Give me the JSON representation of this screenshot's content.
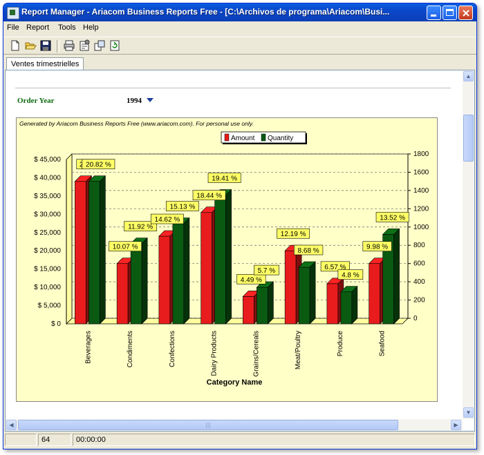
{
  "window": {
    "title": "Report Manager - Ariacom Business Reports Free - [C:\\Archivos de programa\\Ariacom\\Busi..."
  },
  "menu": [
    "File",
    "Report",
    "Tools",
    "Help"
  ],
  "toolbar": {
    "icons": [
      "new-icon",
      "open-icon",
      "save-icon",
      "print-icon",
      "properties-icon",
      "export-icon",
      "refresh-icon"
    ]
  },
  "tab": {
    "label": "Ventes trimestrielles"
  },
  "filter": {
    "label": "Order Year",
    "value": "1994"
  },
  "chart_caption": "Generated by Ariacom Business Reports Free (www.ariacom.com). For personal use only.",
  "chart_data": {
    "type": "bar",
    "xlabel": "Category Name",
    "categories": [
      "Beverages",
      "Condiments",
      "Confections",
      "Dairy Products",
      "Grains/Cereals",
      "Meat/Poultry",
      "Produce",
      "Seafood"
    ],
    "series": [
      {
        "name": "Amount",
        "axis": "left",
        "color": "#e81c1c",
        "values": [
          39000,
          16500,
          24000,
          30500,
          7500,
          20000,
          11000,
          16500
        ],
        "labels": [
          "23",
          "10.07 %",
          "14.62 %",
          "18.44 %",
          "4.49 %",
          "12.19 %",
          "6.57 %",
          "9.98 %"
        ]
      },
      {
        "name": "Quantity",
        "axis": "right",
        "color": "#0a5a12",
        "values": [
          1560,
          880,
          1100,
          1410,
          400,
          620,
          350,
          980
        ],
        "labels": [
          "20.82 %",
          "11.92 %",
          "15.13 %",
          "19.41 %",
          "5.7 %",
          "8.68 %",
          "4.8 %",
          "13.52 %"
        ]
      }
    ],
    "left_axis": {
      "ylim": [
        0,
        45000
      ],
      "ticks": [
        "$ 0",
        "$ 5,000",
        "$ 10,000",
        "$ 15,000",
        "$ 20,000",
        "$ 25,000",
        "$ 30,000",
        "$ 35,000",
        "$ 40,000",
        "$ 45,000"
      ]
    },
    "right_axis": {
      "ylim": [
        0,
        1800
      ],
      "ticks": [
        "0",
        "200",
        "400",
        "600",
        "800",
        "1000",
        "1200",
        "1400",
        "1600",
        "1800"
      ]
    },
    "legend": [
      "Amount",
      "Quantity"
    ],
    "legend_position": "top-center",
    "grid": true
  },
  "status": {
    "count": "64",
    "time": "00:00:00"
  },
  "colors": {
    "amount": "#e81c1c",
    "quantity": "#0a5a12",
    "plot_bg": "#ffffc8",
    "label_bg": "#ffff66",
    "title_green": "#0b6b10"
  }
}
